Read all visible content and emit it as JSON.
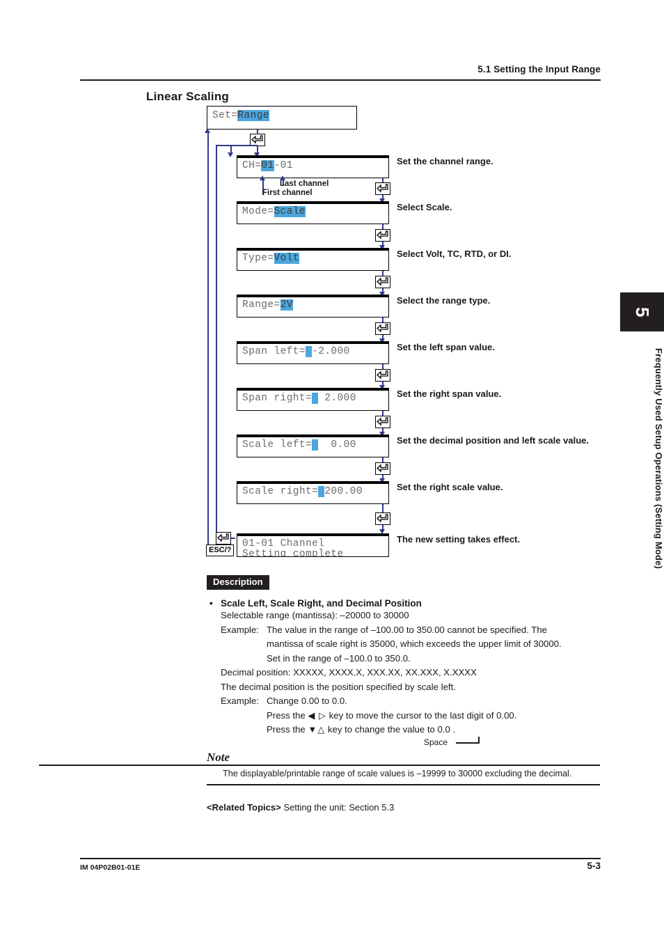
{
  "header": {
    "title": "5.1  Setting the Input Range"
  },
  "page_title": "Linear Scaling",
  "flow": {
    "steps": [
      {
        "id": "set",
        "l1_pre": "Set=",
        "l1_hl": "Range",
        "l1_post": "",
        "caption": ""
      },
      {
        "id": "ch",
        "l1_pre": "CH=",
        "l1_hl": "01",
        "l1_post": "-01",
        "caption": "Set the channel range."
      },
      {
        "id": "mode",
        "l1_pre": "Mode=",
        "l1_hl": "Scale",
        "l1_post": "",
        "caption": "Select Scale."
      },
      {
        "id": "type",
        "l1_pre": "Type=",
        "l1_hl": "Volt",
        "l1_post": "",
        "caption": "Select Volt, TC, RTD, or DI."
      },
      {
        "id": "range",
        "l1_pre": "Range=",
        "l1_hl": "2V",
        "l1_post": "",
        "caption": "Select the range type."
      },
      {
        "id": "span-left",
        "l1_pre": "Span left=",
        "l1_cur": "_",
        "l1_post": "-2.000",
        "caption": "Set the left span value."
      },
      {
        "id": "span-right",
        "l1_pre": "Span right=",
        "l1_cur": "_",
        "l1_post": " 2.000",
        "caption": "Set the right span value."
      },
      {
        "id": "scale-left",
        "l1_pre": "Scale left=",
        "l1_cur": "_",
        "l1_post": "  0.00",
        "caption": "Set the decimal position and left scale value."
      },
      {
        "id": "scale-right",
        "l1_pre": "Scale right=",
        "l1_cur": "_",
        "l1_post": "200.00",
        "caption": "Set the right scale value."
      },
      {
        "id": "complete",
        "l1_pre": "01-01 Channel",
        "l2": "Setting complete",
        "caption": "The new setting takes effect."
      }
    ],
    "first_channel_label": "First channel",
    "last_channel_label": "Last channel",
    "esc_key_label": "ESC/?",
    "enter_key_name": "enter-key"
  },
  "description": {
    "tag": "Description",
    "bullet_title": "Scale Left, Scale Right, and Decimal Position",
    "selectable_range": "Selectable range (mantissa): –20000 to 30000",
    "example_label_1": "Example:",
    "example_1_line1": "The value in the range of –100.00 to 350.00 cannot be specified. The",
    "example_1_line2": "mantissa of scale right is 35000, which exceeds the upper limit of 30000.",
    "example_1_line3": "Set in the range of –100.0 to 350.0.",
    "decimal_position": "Decimal position: XXXXX, XXXX.X, XXX.XX, XX.XXX, X.XXXX",
    "decimal_note": "The decimal position is the position specified by scale left.",
    "example_label_2": "Example:",
    "example_2_line1": "Change 0.00 to 0.0.",
    "example_2_line2_a": "Press the ",
    "example_2_line2_keys": "◀ ▷",
    "example_2_line2_b": " key to move the cursor to the last digit of 0.00.",
    "example_2_line3_a": "Press the ",
    "example_2_line3_keys": "▼△",
    "example_2_line3_b": " key to change the value to 0.0  .",
    "space_label": "Space"
  },
  "note": {
    "title": "Note",
    "body": "The displayable/printable range of scale values is –19999 to 30000 excluding the decimal."
  },
  "related": {
    "label": "<Related Topics>",
    "text": "Setting the unit: Section 5.3"
  },
  "side_tab": {
    "number": "5",
    "text": "Frequently Used Setup Operations (Setting Mode)"
  },
  "footer": {
    "left": "IM 04P02B01-01E",
    "right": "5-3"
  },
  "colors": {
    "highlight": "#4da6dd",
    "line": "#2f3a8c",
    "ink": "#1a1a1a"
  }
}
